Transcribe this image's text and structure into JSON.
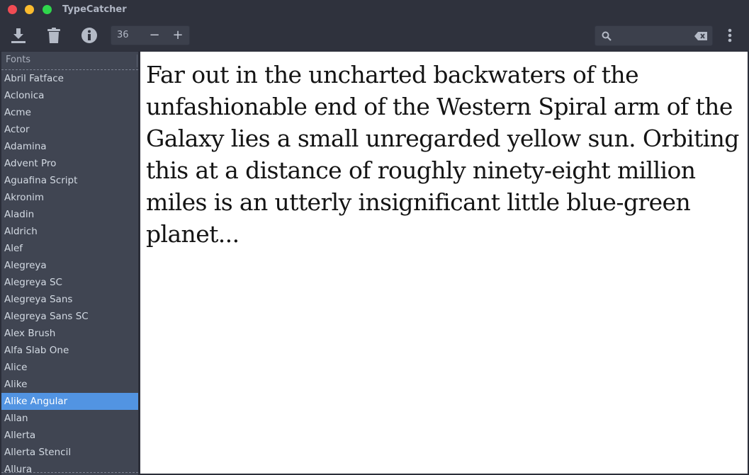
{
  "window": {
    "title": "TypeCatcher",
    "controls": [
      "close",
      "minimize",
      "maximize"
    ]
  },
  "toolbar": {
    "download_icon": "download-icon",
    "delete_icon": "trash-icon",
    "info_icon": "info-icon",
    "font_size": "36",
    "decrease_label": "−",
    "increase_label": "+",
    "search": {
      "value": "",
      "placeholder": "",
      "search_icon": "search-icon",
      "clear_icon": "backspace-clear-icon"
    },
    "menu_icon": "kebab-menu-icon"
  },
  "sidebar": {
    "header": "Fonts",
    "selected": "Alike Angular",
    "items": [
      {
        "label": "Abril Fatface"
      },
      {
        "label": "Aclonica"
      },
      {
        "label": "Acme"
      },
      {
        "label": "Actor"
      },
      {
        "label": "Adamina"
      },
      {
        "label": "Advent Pro"
      },
      {
        "label": "Aguafina Script"
      },
      {
        "label": "Akronim"
      },
      {
        "label": "Aladin"
      },
      {
        "label": "Aldrich"
      },
      {
        "label": "Alef"
      },
      {
        "label": "Alegreya"
      },
      {
        "label": "Alegreya SC"
      },
      {
        "label": "Alegreya Sans"
      },
      {
        "label": "Alegreya Sans SC"
      },
      {
        "label": "Alex Brush"
      },
      {
        "label": "Alfa Slab One"
      },
      {
        "label": "Alice"
      },
      {
        "label": "Alike"
      },
      {
        "label": "Alike Angular"
      },
      {
        "label": "Allan"
      },
      {
        "label": "Allerta"
      },
      {
        "label": "Allerta Stencil"
      },
      {
        "label": "Allura"
      }
    ]
  },
  "preview": {
    "text": "Far out in the uncharted backwaters of the unfashionable end of the Western Spiral arm of the Galaxy lies a small unregarded yellow sun. Orbiting this at a distance of roughly ninety-eight million miles is an utterly insignificant little blue-green planet..."
  },
  "colors": {
    "accent": "#5294e2",
    "titlebar": "#2f323d",
    "sidebar": "#404552",
    "close": "#f04c54",
    "minimize": "#fbbb2e",
    "maximize": "#2fd64c"
  }
}
